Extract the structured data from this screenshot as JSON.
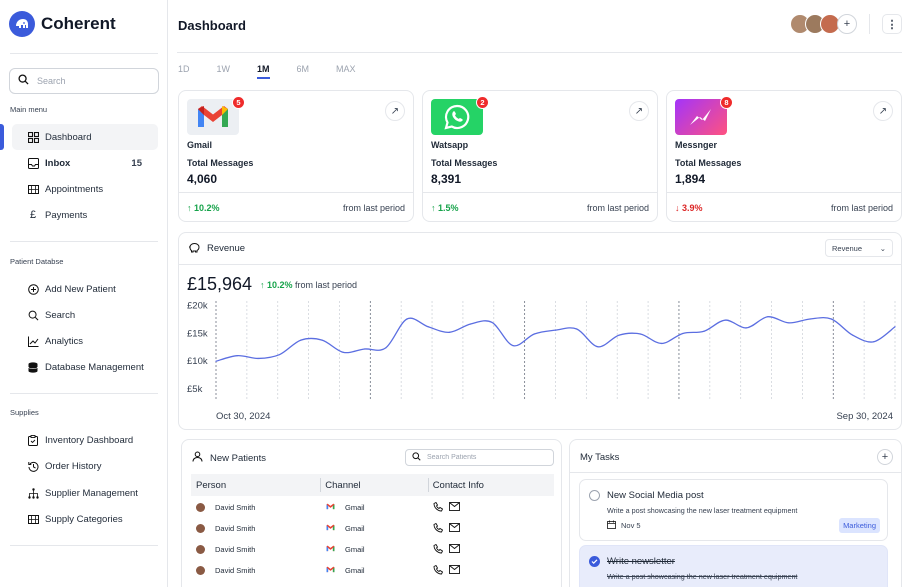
{
  "brand": {
    "name": "Coherent",
    "color": "#3b5bdb"
  },
  "sidebar": {
    "search_placeholder": "Search",
    "main_menu_label": "Main menu",
    "main_items": [
      {
        "label": "Dashboard",
        "icon": "dashboard-grid-icon",
        "active": true
      },
      {
        "label": "Inbox",
        "icon": "inbox-icon",
        "count": "15"
      },
      {
        "label": "Appointments",
        "icon": "calendar-icon"
      },
      {
        "label": "Payments",
        "icon": "pound-icon"
      }
    ],
    "patient_section_label": "Patient Databse",
    "patient_items": [
      {
        "label": "Add New Patient",
        "icon": "plus-circle-icon"
      },
      {
        "label": "Search",
        "icon": "search-icon"
      },
      {
        "label": "Analytics",
        "icon": "line-chart-icon"
      },
      {
        "label": "Database Management",
        "icon": "database-icon"
      }
    ],
    "supplies_section_label": "Supplies",
    "supplies_items": [
      {
        "label": "Inventory Dashboard",
        "icon": "clipboard-icon"
      },
      {
        "label": "Order History",
        "icon": "history-icon"
      },
      {
        "label": "Supplier Management",
        "icon": "hierarchy-icon"
      },
      {
        "label": "Supply Categories",
        "icon": "table-icon"
      }
    ]
  },
  "header": {
    "title": "Dashboard",
    "add_label": "+",
    "menu_label": "⋮"
  },
  "periods": [
    {
      "label": "1D"
    },
    {
      "label": "1W"
    },
    {
      "label": "1M",
      "active": true
    },
    {
      "label": "6M"
    },
    {
      "label": "MAX"
    }
  ],
  "stats": [
    {
      "app": "Gmail",
      "badge": "5",
      "label": "Total Messages",
      "value": "4,060",
      "delta": "↑ 10.2%",
      "trend": "up",
      "footer": "from last period",
      "icon": "gmail-icon"
    },
    {
      "app": "Watsapp",
      "badge": "2",
      "label": "Total Messages",
      "value": "8,391",
      "delta": "↑ 1.5%",
      "trend": "up",
      "footer": "from last period",
      "icon": "whatsapp-icon"
    },
    {
      "app": "Messnger",
      "badge": "8",
      "label": "Total Messages",
      "value": "1,894",
      "delta": "↓ 3.9%",
      "trend": "down",
      "footer": "from last period",
      "icon": "messenger-icon"
    }
  ],
  "revenue": {
    "title": "Revenue",
    "select_value": "Revenue",
    "total": "£15,964",
    "delta": "↑ 10.2%",
    "delta_suffix": " from last period"
  },
  "chart_data": {
    "type": "line",
    "ylim": [
      3000,
      21000
    ],
    "y_ticks": [
      "£20k",
      "£15k",
      "£10k",
      "£5k"
    ],
    "y_tick_values": [
      20000,
      15000,
      10000,
      5000
    ],
    "x_start_label": "Oct 30, 2024",
    "x_end_label": "Sep 30, 2024",
    "values": [
      9800,
      10800,
      10300,
      11000,
      13600,
      13600,
      11400,
      12000,
      12200,
      17400,
      16000,
      15000,
      16500,
      16800,
      12600,
      14700,
      15400,
      15600,
      12400,
      14500,
      14700,
      13000,
      14800,
      15200,
      17200,
      15800,
      17800,
      16700,
      17400,
      17400,
      14500,
      13300,
      16000
    ],
    "color": "#5b6ee1"
  },
  "new_patients": {
    "title": "New Patients",
    "search_placeholder": "Search Patients",
    "columns": [
      "Person",
      "Channel",
      "Contact Info"
    ],
    "rows": [
      {
        "person": "David Smith",
        "channel": "Gmail"
      },
      {
        "person": "David Smith",
        "channel": "Gmail"
      },
      {
        "person": "David Smith",
        "channel": "Gmail"
      },
      {
        "person": "David Smith",
        "channel": "Gmail"
      }
    ]
  },
  "tasks": {
    "title": "My Tasks",
    "add_label": "+",
    "items": [
      {
        "title": "New Social Media post",
        "desc": "Write a post showcasing the new laser treatment equipment",
        "date": "Nov 5",
        "tag": "Marketing",
        "done": false
      },
      {
        "title": "Write newsletter",
        "desc": "Write a post showcasing the new laser treatment equipment",
        "done": true
      }
    ]
  }
}
